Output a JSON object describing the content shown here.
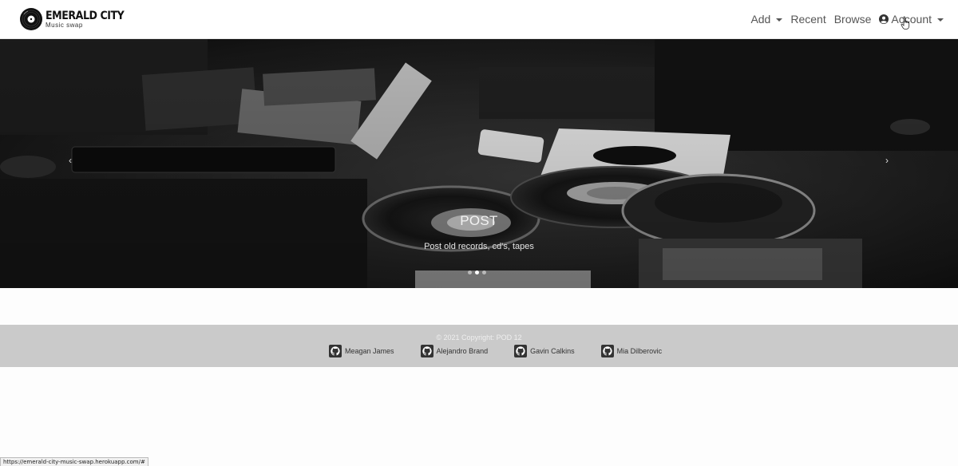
{
  "brand": {
    "title": "EMERALD CITY",
    "subtitle": "Music swap"
  },
  "nav": {
    "items": [
      {
        "label": "Add",
        "dropdown": true
      },
      {
        "label": "Recent",
        "dropdown": false
      },
      {
        "label": "Browse",
        "dropdown": false
      },
      {
        "label": "Account",
        "dropdown": true,
        "icon": "user-circle-icon"
      }
    ]
  },
  "hero": {
    "caption_title": "POST",
    "caption_text": "Post old records, cd's, tapes",
    "prev_glyph": "‹",
    "next_glyph": "›",
    "slide_count": 3,
    "active_slide": 2
  },
  "footer": {
    "copyright": "© 2021 Copyright: POD 12",
    "contributors": [
      "Meagan James",
      "Alejandro Brand",
      "Gavin Calkins",
      "Mia Dilberovic"
    ]
  },
  "status_bar": {
    "url": "https://emerald-city-music-swap.herokuapp.com/#"
  },
  "colors": {
    "navbar_bg": "#ffffff",
    "footer_bg": "#cacaca",
    "page_bg": "#fdfdfd",
    "text_muted": "#555555"
  }
}
